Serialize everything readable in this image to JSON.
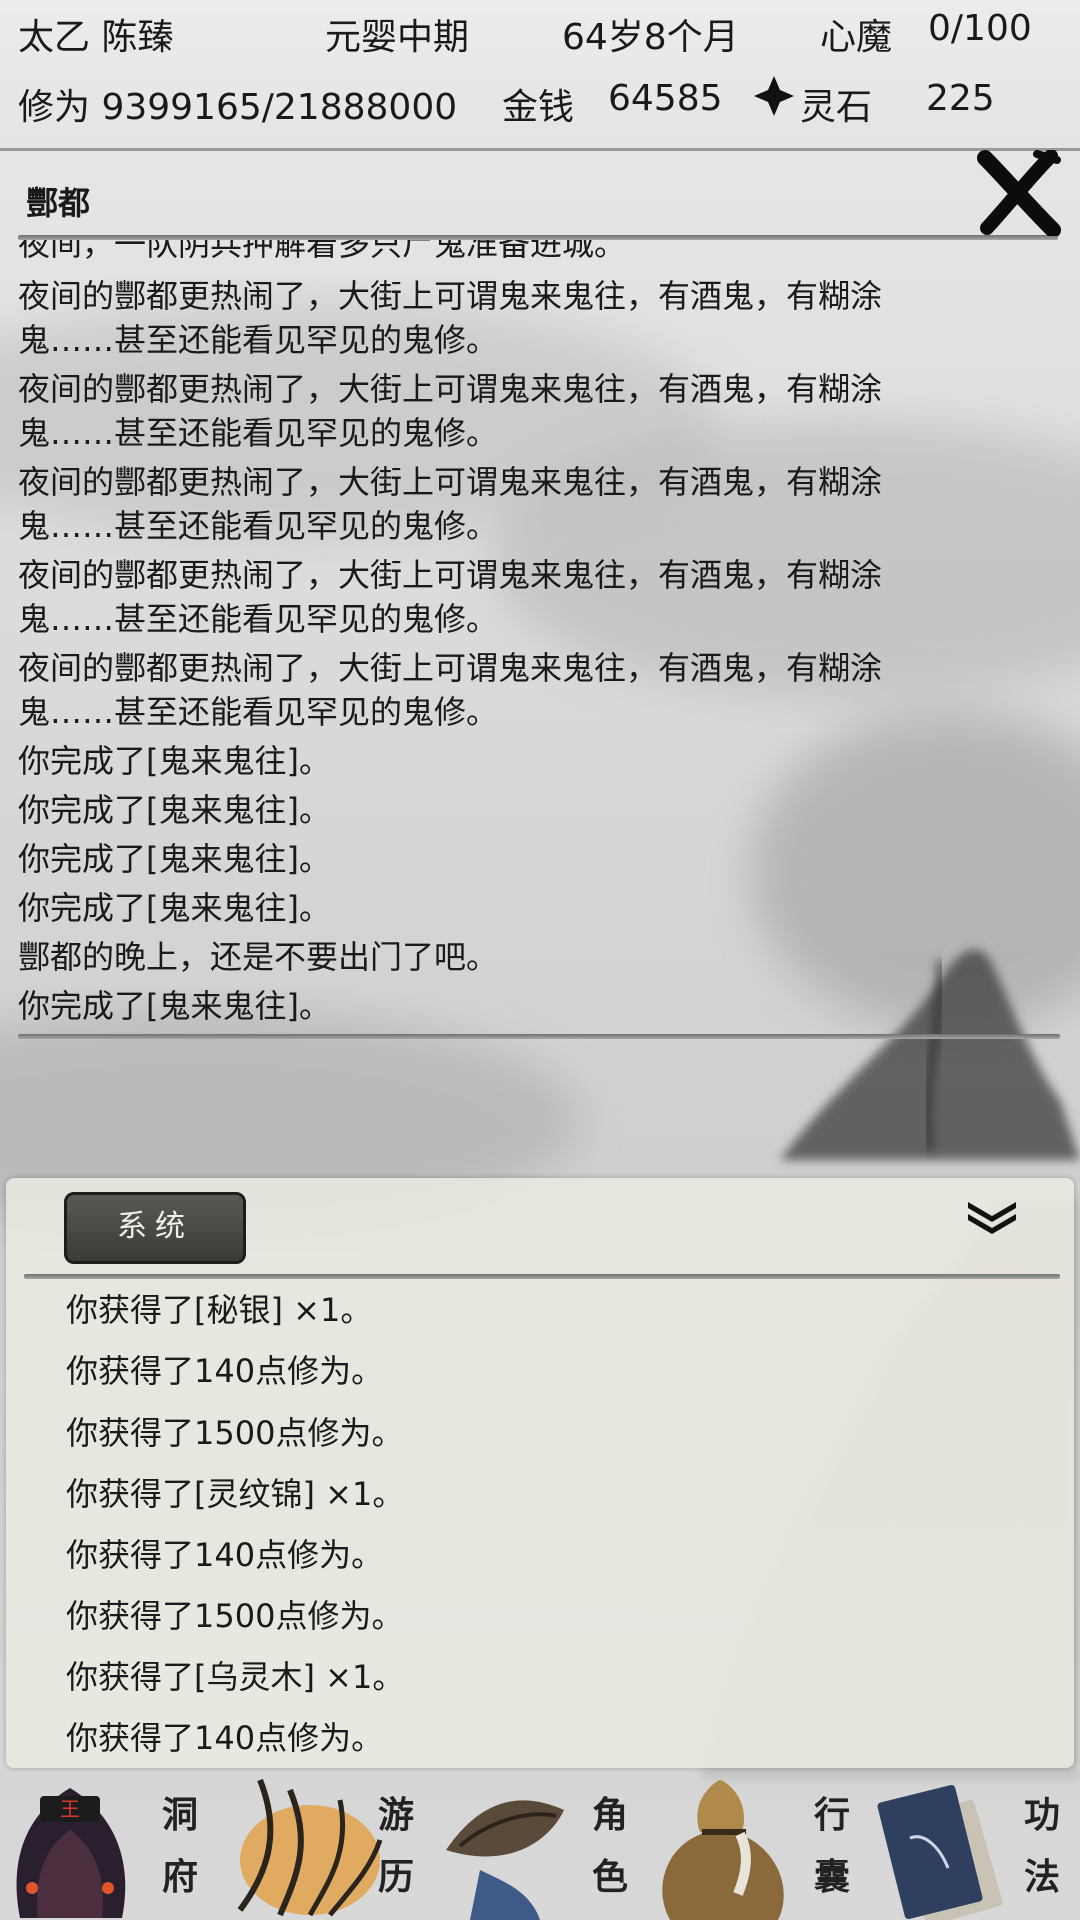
{
  "status": {
    "name": "太乙 陈臻",
    "realm": "元婴中期",
    "age": "64岁8个月",
    "demon_label": "心魔",
    "demon_value": "0/100",
    "cultivation": "修为 9399165/21888000",
    "money_label": "金钱",
    "money_value": "64585",
    "stone_label": "灵石",
    "stone_value": "225",
    "stone_icon": "spirit-stone-icon"
  },
  "location": {
    "title": "酆都",
    "close_icon": "close-x-icon"
  },
  "story_log": [
    "夜间，一队阴兵押解着多只尸鬼准备进城。",
    "夜间的酆都更热闹了，大街上可谓鬼来鬼往，有酒鬼，有糊涂",
    "鬼……甚至还能看见罕见的鬼修。",
    "夜间的酆都更热闹了，大街上可谓鬼来鬼往，有酒鬼，有糊涂",
    "鬼……甚至还能看见罕见的鬼修。",
    "夜间的酆都更热闹了，大街上可谓鬼来鬼往，有酒鬼，有糊涂",
    "鬼……甚至还能看见罕见的鬼修。",
    "夜间的酆都更热闹了，大街上可谓鬼来鬼往，有酒鬼，有糊涂",
    "鬼……甚至还能看见罕见的鬼修。",
    "夜间的酆都更热闹了，大街上可谓鬼来鬼往，有酒鬼，有糊涂",
    "鬼……甚至还能看见罕见的鬼修。",
    "你完成了[鬼来鬼往]。",
    "你完成了[鬼来鬼往]。",
    "你完成了[鬼来鬼往]。",
    "你完成了[鬼来鬼往]。",
    "酆都的晚上，还是不要出门了吧。",
    "你完成了[鬼来鬼往]。"
  ],
  "system": {
    "tab_label": "系统",
    "collapse_icon": "double-chevron-down-icon",
    "lines": [
      "你获得了[秘银] ×1。",
      "你获得了140点修为。",
      "你获得了1500点修为。",
      "你获得了[灵纹锦] ×1。",
      "你获得了140点修为。",
      "你获得了1500点修为。",
      "你获得了[乌灵木] ×1。",
      "你获得了140点修为。"
    ]
  },
  "nav": {
    "items": [
      {
        "label_top": "洞",
        "label_bottom": "府",
        "icon": "cave-mansion-icon"
      },
      {
        "label_top": "游",
        "label_bottom": "历",
        "icon": "travel-grass-icon"
      },
      {
        "label_top": "角",
        "label_bottom": "色",
        "icon": "bamboo-hat-icon"
      },
      {
        "label_top": "行",
        "label_bottom": "囊",
        "icon": "sack-bag-icon"
      },
      {
        "label_top": "功",
        "label_bottom": "法",
        "icon": "scroll-book-icon"
      }
    ]
  }
}
